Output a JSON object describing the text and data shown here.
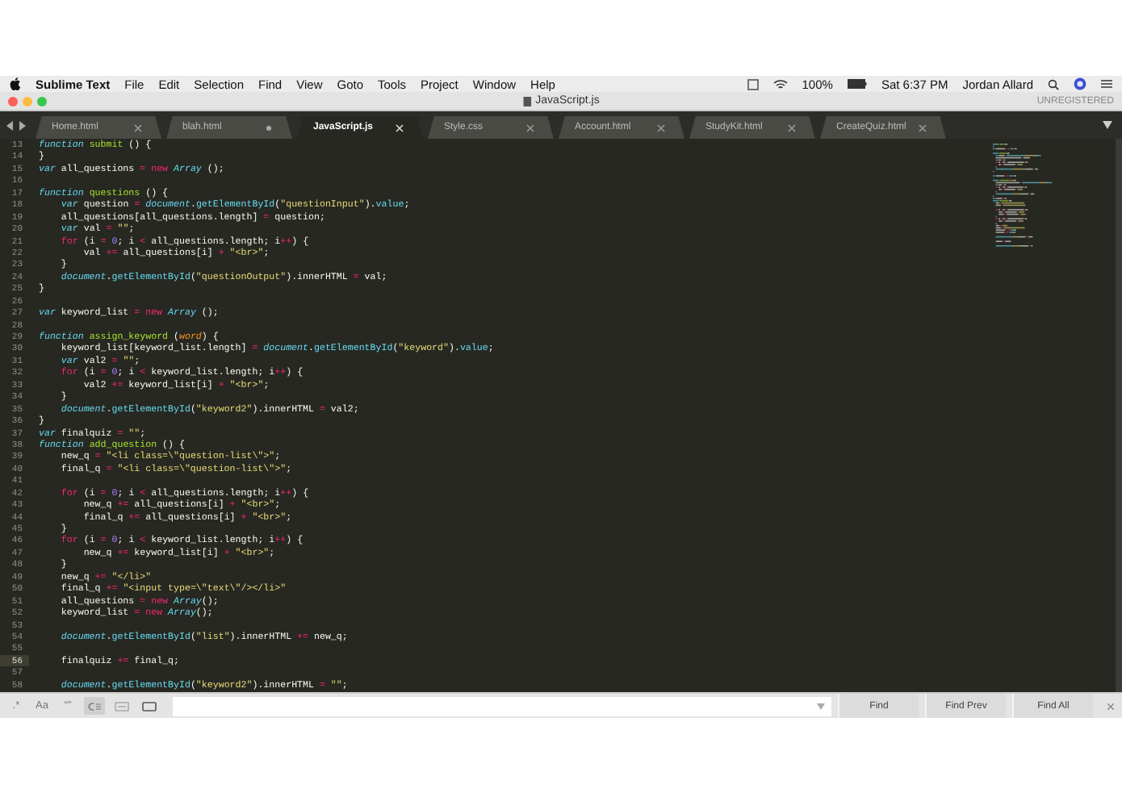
{
  "menu_bar": {
    "app": "Sublime Text",
    "menus": [
      "File",
      "Edit",
      "Selection",
      "Find",
      "View",
      "Goto",
      "Tools",
      "Project",
      "Window",
      "Help"
    ],
    "battery": "100%",
    "clock": "Sat 6:37 PM",
    "user": "Jordan Allard"
  },
  "window": {
    "title": "JavaScript.js",
    "license": "UNREGISTERED"
  },
  "tabs": [
    {
      "label": "Home.html",
      "selected": false,
      "modified": false
    },
    {
      "label": "blah.html",
      "selected": false,
      "modified": true
    },
    {
      "label": "JavaScript.js",
      "selected": true,
      "modified": false
    },
    {
      "label": "Style.css",
      "selected": false,
      "modified": false
    },
    {
      "label": "Account.html",
      "selected": false,
      "modified": false
    },
    {
      "label": "StudyKit.html",
      "selected": false,
      "modified": false
    },
    {
      "label": "CreateQuiz.html",
      "selected": false,
      "modified": false
    }
  ],
  "editor": {
    "lines": [
      {
        "number": "13",
        "current": false,
        "tokens": [
          {
            "text": "function",
            "kind": "keyword"
          },
          {
            "text": " submit",
            "kind": "function"
          },
          {
            "text": " () {",
            "kind": "plain"
          }
        ]
      },
      {
        "number": "14",
        "current": false,
        "tokens": [
          {
            "text": "}",
            "kind": "plain"
          }
        ]
      },
      {
        "number": "15",
        "current": false,
        "tokens": [
          {
            "text": "var",
            "kind": "keyword"
          },
          {
            "text": " all_questions ",
            "kind": "plain"
          },
          {
            "text": "=",
            "kind": "operator"
          },
          {
            "text": " new",
            "kind": "operator"
          },
          {
            "text": " Array",
            "kind": "type"
          },
          {
            "text": " ();",
            "kind": "plain"
          }
        ]
      },
      {
        "number": "16",
        "current": false
      },
      {
        "number": "17",
        "current": false,
        "tokens": [
          {
            "text": "function",
            "kind": "keyword"
          },
          {
            "text": " questions",
            "kind": "function"
          },
          {
            "text": " () {",
            "kind": "plain"
          }
        ]
      },
      {
        "number": "18",
        "current": false,
        "tokens": [
          {
            "text": "    var",
            "kind": "keyword"
          },
          {
            "text": " question ",
            "kind": "plain"
          },
          {
            "text": "=",
            "kind": "operator"
          },
          {
            "text": " document",
            "kind": "type"
          },
          {
            "text": ".",
            "kind": "plain"
          },
          {
            "text": "getElementById",
            "kind": "property"
          },
          {
            "text": "(",
            "kind": "plain"
          },
          {
            "text": "\"questionInput\"",
            "kind": "string"
          },
          {
            "text": ").",
            "kind": "plain"
          },
          {
            "text": "value",
            "kind": "property"
          },
          {
            "text": ";",
            "kind": "plain"
          }
        ]
      },
      {
        "number": "19",
        "current": false,
        "tokens": [
          {
            "text": "    all_questions[all_questions.length] ",
            "kind": "plain"
          },
          {
            "text": "=",
            "kind": "operator"
          },
          {
            "text": " question;",
            "kind": "plain"
          }
        ]
      },
      {
        "number": "20",
        "current": false,
        "tokens": [
          {
            "text": "    var",
            "kind": "keyword"
          },
          {
            "text": " val ",
            "kind": "plain"
          },
          {
            "text": "=",
            "kind": "operator"
          },
          {
            "text": " \"\"",
            "kind": "string"
          },
          {
            "text": ";",
            "kind": "plain"
          }
        ]
      },
      {
        "number": "21",
        "current": false,
        "tokens": [
          {
            "text": "    for",
            "kind": "operator"
          },
          {
            "text": " (i ",
            "kind": "plain"
          },
          {
            "text": "=",
            "kind": "operator"
          },
          {
            "text": " 0",
            "kind": "number"
          },
          {
            "text": "; i ",
            "kind": "plain"
          },
          {
            "text": "<",
            "kind": "operator"
          },
          {
            "text": " all_questions.length; i",
            "kind": "plain"
          },
          {
            "text": "++",
            "kind": "operator"
          },
          {
            "text": ") {",
            "kind": "plain"
          }
        ]
      },
      {
        "number": "22",
        "current": false,
        "tokens": [
          {
            "text": "        val ",
            "kind": "plain"
          },
          {
            "text": "+=",
            "kind": "operator"
          },
          {
            "text": " all_questions[i] ",
            "kind": "plain"
          },
          {
            "text": "+",
            "kind": "operator"
          },
          {
            "text": " \"<br>\"",
            "kind": "string"
          },
          {
            "text": ";",
            "kind": "plain"
          }
        ]
      },
      {
        "number": "23",
        "current": false,
        "tokens": [
          {
            "text": "    }",
            "kind": "plain"
          }
        ]
      },
      {
        "number": "24",
        "current": false,
        "tokens": [
          {
            "text": "    document",
            "kind": "type"
          },
          {
            "text": ".",
            "kind": "plain"
          },
          {
            "text": "getElementById",
            "kind": "property"
          },
          {
            "text": "(",
            "kind": "plain"
          },
          {
            "text": "\"questionOutput\"",
            "kind": "string"
          },
          {
            "text": ").innerHTML ",
            "kind": "plain"
          },
          {
            "text": "=",
            "kind": "operator"
          },
          {
            "text": " val;",
            "kind": "plain"
          }
        ]
      },
      {
        "number": "25",
        "current": false,
        "tokens": [
          {
            "text": "}",
            "kind": "plain"
          }
        ]
      },
      {
        "number": "26",
        "current": false
      },
      {
        "number": "27",
        "current": false,
        "tokens": [
          {
            "text": "var",
            "kind": "keyword"
          },
          {
            "text": " keyword_list ",
            "kind": "plain"
          },
          {
            "text": "=",
            "kind": "operator"
          },
          {
            "text": " new",
            "kind": "operator"
          },
          {
            "text": " Array",
            "kind": "type"
          },
          {
            "text": " ();",
            "kind": "plain"
          }
        ]
      },
      {
        "number": "28",
        "current": false
      },
      {
        "number": "29",
        "current": false,
        "tokens": [
          {
            "text": "function",
            "kind": "keyword"
          },
          {
            "text": " assign_keyword",
            "kind": "function"
          },
          {
            "text": " (",
            "kind": "plain"
          },
          {
            "text": "word",
            "kind": "param"
          },
          {
            "text": ") {",
            "kind": "plain"
          }
        ]
      },
      {
        "number": "30",
        "current": false,
        "tokens": [
          {
            "text": "    keyword_list[keyword_list.length] ",
            "kind": "plain"
          },
          {
            "text": "=",
            "kind": "operator"
          },
          {
            "text": " document",
            "kind": "type"
          },
          {
            "text": ".",
            "kind": "plain"
          },
          {
            "text": "getElementById",
            "kind": "property"
          },
          {
            "text": "(",
            "kind": "plain"
          },
          {
            "text": "\"keyword\"",
            "kind": "string"
          },
          {
            "text": ").",
            "kind": "plain"
          },
          {
            "text": "value",
            "kind": "property"
          },
          {
            "text": ";",
            "kind": "plain"
          }
        ]
      },
      {
        "number": "31",
        "current": false,
        "tokens": [
          {
            "text": "    var",
            "kind": "keyword"
          },
          {
            "text": " val2 ",
            "kind": "plain"
          },
          {
            "text": "=",
            "kind": "operator"
          },
          {
            "text": " \"\"",
            "kind": "string"
          },
          {
            "text": ";",
            "kind": "plain"
          }
        ]
      },
      {
        "number": "32",
        "current": false,
        "tokens": [
          {
            "text": "    for",
            "kind": "operator"
          },
          {
            "text": " (i ",
            "kind": "plain"
          },
          {
            "text": "=",
            "kind": "operator"
          },
          {
            "text": " 0",
            "kind": "number"
          },
          {
            "text": "; i ",
            "kind": "plain"
          },
          {
            "text": "<",
            "kind": "operator"
          },
          {
            "text": " keyword_list.length; i",
            "kind": "plain"
          },
          {
            "text": "++",
            "kind": "operator"
          },
          {
            "text": ") {",
            "kind": "plain"
          }
        ]
      },
      {
        "number": "33",
        "current": false,
        "tokens": [
          {
            "text": "        val2 ",
            "kind": "plain"
          },
          {
            "text": "+=",
            "kind": "operator"
          },
          {
            "text": " keyword_list[i] ",
            "kind": "plain"
          },
          {
            "text": "+",
            "kind": "operator"
          },
          {
            "text": " \"<br>\"",
            "kind": "string"
          },
          {
            "text": ";",
            "kind": "plain"
          }
        ]
      },
      {
        "number": "34",
        "current": false,
        "tokens": [
          {
            "text": "    }",
            "kind": "plain"
          }
        ]
      },
      {
        "number": "35",
        "current": false,
        "tokens": [
          {
            "text": "    document",
            "kind": "type"
          },
          {
            "text": ".",
            "kind": "plain"
          },
          {
            "text": "getElementById",
            "kind": "property"
          },
          {
            "text": "(",
            "kind": "plain"
          },
          {
            "text": "\"keyword2\"",
            "kind": "string"
          },
          {
            "text": ").innerHTML ",
            "kind": "plain"
          },
          {
            "text": "=",
            "kind": "operator"
          },
          {
            "text": " val2;",
            "kind": "plain"
          }
        ]
      },
      {
        "number": "36",
        "current": false,
        "tokens": [
          {
            "text": "}",
            "kind": "plain"
          }
        ]
      },
      {
        "number": "37",
        "current": false,
        "tokens": [
          {
            "text": "var",
            "kind": "keyword"
          },
          {
            "text": " finalquiz ",
            "kind": "plain"
          },
          {
            "text": "=",
            "kind": "operator"
          },
          {
            "text": " \"\"",
            "kind": "string"
          },
          {
            "text": ";",
            "kind": "plain"
          }
        ]
      },
      {
        "number": "38",
        "current": false,
        "tokens": [
          {
            "text": "function",
            "kind": "keyword"
          },
          {
            "text": " add_question",
            "kind": "function"
          },
          {
            "text": " () {",
            "kind": "plain"
          }
        ]
      },
      {
        "number": "39",
        "current": false,
        "tokens": [
          {
            "text": "    new_q ",
            "kind": "plain"
          },
          {
            "text": "=",
            "kind": "operator"
          },
          {
            "text": " \"<li class=\\\"question-list\\\">\"",
            "kind": "string"
          },
          {
            "text": ";",
            "kind": "plain"
          }
        ]
      },
      {
        "number": "40",
        "current": false,
        "tokens": [
          {
            "text": "    final_q ",
            "kind": "plain"
          },
          {
            "text": "=",
            "kind": "operator"
          },
          {
            "text": " \"<li class=\\\"question-list\\\">\"",
            "kind": "string"
          },
          {
            "text": ";",
            "kind": "plain"
          }
        ]
      },
      {
        "number": "41",
        "current": false
      },
      {
        "number": "42",
        "current": false,
        "tokens": [
          {
            "text": "    for",
            "kind": "operator"
          },
          {
            "text": " (i ",
            "kind": "plain"
          },
          {
            "text": "=",
            "kind": "operator"
          },
          {
            "text": " 0",
            "kind": "number"
          },
          {
            "text": "; i ",
            "kind": "plain"
          },
          {
            "text": "<",
            "kind": "operator"
          },
          {
            "text": " all_questions.length; i",
            "kind": "plain"
          },
          {
            "text": "++",
            "kind": "operator"
          },
          {
            "text": ") {",
            "kind": "plain"
          }
        ]
      },
      {
        "number": "43",
        "current": false,
        "tokens": [
          {
            "text": "        new_q ",
            "kind": "plain"
          },
          {
            "text": "+=",
            "kind": "operator"
          },
          {
            "text": " all_questions[i] ",
            "kind": "plain"
          },
          {
            "text": "+",
            "kind": "operator"
          },
          {
            "text": " \"<br>\"",
            "kind": "string"
          },
          {
            "text": ";",
            "kind": "plain"
          }
        ]
      },
      {
        "number": "44",
        "current": false,
        "tokens": [
          {
            "text": "        final_q ",
            "kind": "plain"
          },
          {
            "text": "+=",
            "kind": "operator"
          },
          {
            "text": " all_questions[i] ",
            "kind": "plain"
          },
          {
            "text": "+",
            "kind": "operator"
          },
          {
            "text": " \"<br>\"",
            "kind": "string"
          },
          {
            "text": ";",
            "kind": "plain"
          }
        ]
      },
      {
        "number": "45",
        "current": false,
        "tokens": [
          {
            "text": "    }",
            "kind": "plain"
          }
        ]
      },
      {
        "number": "46",
        "current": false,
        "tokens": [
          {
            "text": "    for",
            "kind": "operator"
          },
          {
            "text": " (i ",
            "kind": "plain"
          },
          {
            "text": "=",
            "kind": "operator"
          },
          {
            "text": " 0",
            "kind": "number"
          },
          {
            "text": "; i ",
            "kind": "plain"
          },
          {
            "text": "<",
            "kind": "operator"
          },
          {
            "text": " keyword_list.length; i",
            "kind": "plain"
          },
          {
            "text": "++",
            "kind": "operator"
          },
          {
            "text": ") {",
            "kind": "plain"
          }
        ]
      },
      {
        "number": "47",
        "current": false,
        "tokens": [
          {
            "text": "        new_q ",
            "kind": "plain"
          },
          {
            "text": "+=",
            "kind": "operator"
          },
          {
            "text": " keyword_list[i] ",
            "kind": "plain"
          },
          {
            "text": "+",
            "kind": "operator"
          },
          {
            "text": " \"<br>\"",
            "kind": "string"
          },
          {
            "text": ";",
            "kind": "plain"
          }
        ]
      },
      {
        "number": "48",
        "current": false,
        "tokens": [
          {
            "text": "    }",
            "kind": "plain"
          }
        ]
      },
      {
        "number": "49",
        "current": false,
        "tokens": [
          {
            "text": "    new_q ",
            "kind": "plain"
          },
          {
            "text": "+=",
            "kind": "operator"
          },
          {
            "text": " \"</li>\"",
            "kind": "string"
          }
        ]
      },
      {
        "number": "50",
        "current": false,
        "tokens": [
          {
            "text": "    final_q ",
            "kind": "plain"
          },
          {
            "text": "+=",
            "kind": "operator"
          },
          {
            "text": " \"<input type=\\\"text\\\"/></li>\"",
            "kind": "string"
          }
        ]
      },
      {
        "number": "51",
        "current": false,
        "tokens": [
          {
            "text": "    all_questions ",
            "kind": "plain"
          },
          {
            "text": "=",
            "kind": "operator"
          },
          {
            "text": " new",
            "kind": "operator"
          },
          {
            "text": " Array",
            "kind": "type"
          },
          {
            "text": "();",
            "kind": "plain"
          }
        ]
      },
      {
        "number": "52",
        "current": false,
        "tokens": [
          {
            "text": "    keyword_list ",
            "kind": "plain"
          },
          {
            "text": "=",
            "kind": "operator"
          },
          {
            "text": " new",
            "kind": "operator"
          },
          {
            "text": " Array",
            "kind": "type"
          },
          {
            "text": "();",
            "kind": "plain"
          }
        ]
      },
      {
        "number": "53",
        "current": false
      },
      {
        "number": "54",
        "current": false,
        "tokens": [
          {
            "text": "    document",
            "kind": "type"
          },
          {
            "text": ".",
            "kind": "plain"
          },
          {
            "text": "getElementById",
            "kind": "property"
          },
          {
            "text": "(",
            "kind": "plain"
          },
          {
            "text": "\"list\"",
            "kind": "string"
          },
          {
            "text": ").innerHTML ",
            "kind": "plain"
          },
          {
            "text": "+=",
            "kind": "operator"
          },
          {
            "text": " new_q;",
            "kind": "plain"
          }
        ]
      },
      {
        "number": "55",
        "current": false
      },
      {
        "number": "56",
        "current": true,
        "tokens": [
          {
            "text": "    finalquiz ",
            "kind": "plain"
          },
          {
            "text": "+=",
            "kind": "operator"
          },
          {
            "text": " final_q;",
            "kind": "plain"
          }
        ]
      },
      {
        "number": "57",
        "current": false
      },
      {
        "number": "58",
        "current": false,
        "tokens": [
          {
            "text": "    document",
            "kind": "type"
          },
          {
            "text": ".",
            "kind": "plain"
          },
          {
            "text": "getElementById",
            "kind": "property"
          },
          {
            "text": "(",
            "kind": "plain"
          },
          {
            "text": "\"keyword2\"",
            "kind": "string"
          },
          {
            "text": ").innerHTML ",
            "kind": "plain"
          },
          {
            "text": "=",
            "kind": "operator"
          },
          {
            "text": " \"\"",
            "kind": "string"
          },
          {
            "text": ";",
            "kind": "plain"
          }
        ]
      }
    ]
  },
  "find_bar": {
    "options": [
      {
        "kind": "text",
        "label": ".*",
        "on": false
      },
      {
        "kind": "text",
        "label": "Aa",
        "on": false
      },
      {
        "kind": "text",
        "label": "“”",
        "on": false
      },
      {
        "kind": "wrap",
        "on": true
      },
      {
        "kind": "selection",
        "on": false
      },
      {
        "kind": "highlight",
        "on": false
      }
    ],
    "buttons": [
      "Find",
      "Find Prev",
      "Find All"
    ]
  }
}
